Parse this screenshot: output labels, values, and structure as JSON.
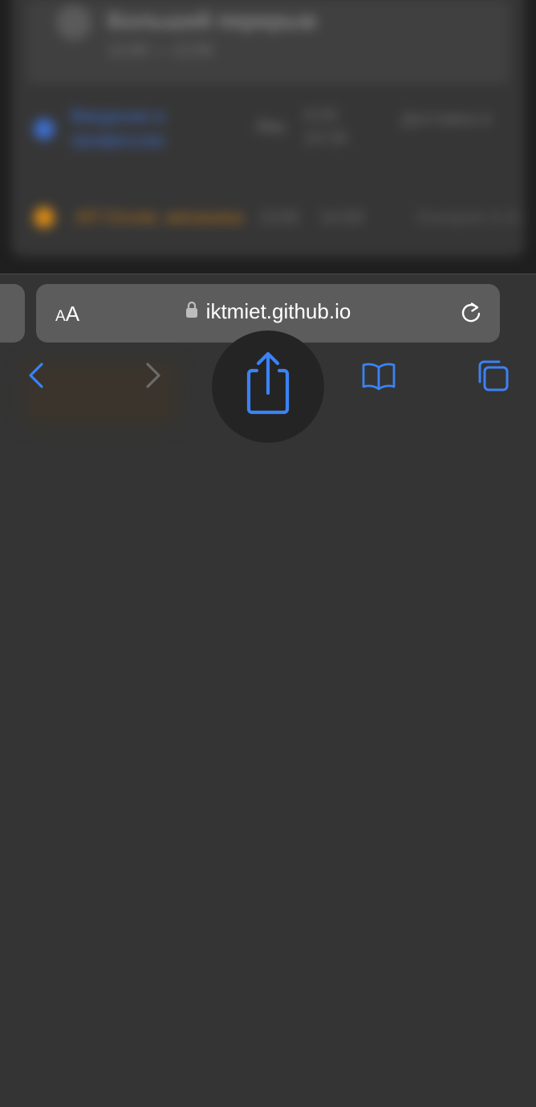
{
  "background_content": {
    "event_title": "Больший перерыв",
    "event_time": "12:00 — 12:50",
    "rows": [
      {
        "text": "Введение в профессию",
        "col2": "Лек.",
        "col3": "9:00 10:30",
        "col4": "Доставка в",
        "color": "#3d6fd0"
      },
      {
        "text": "АП Основ. механика",
        "col2": "2105",
        "col3": "14:00",
        "col4": "Кокарев А.И.",
        "color": "#d98a17"
      }
    ]
  },
  "toolbar": {
    "text_size_label_small": "A",
    "text_size_label_large": "A",
    "url": "iktmiet.github.io",
    "accent_color": "#3b82f6",
    "disabled_color": "#6b6b6b"
  },
  "icons": {
    "lock": "lock-icon",
    "reload": "reload-icon",
    "back": "chevron-left-icon",
    "forward": "chevron-right-icon",
    "share": "share-icon",
    "bookmarks": "book-icon",
    "tabs": "tabs-icon"
  }
}
